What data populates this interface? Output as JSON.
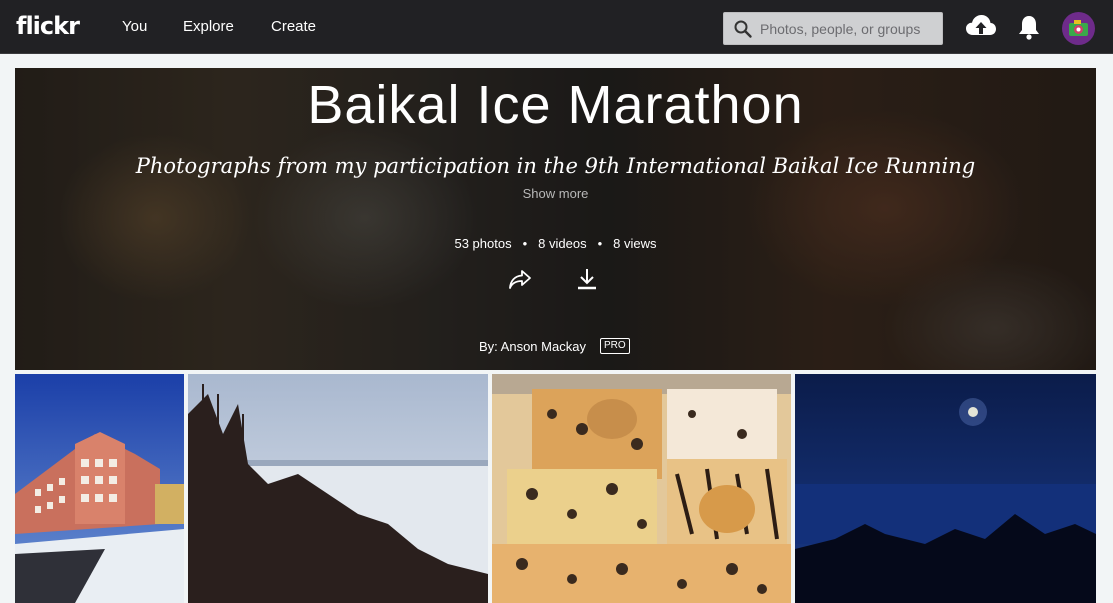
{
  "topbar": {
    "logo": "flickr",
    "nav": {
      "you": "You",
      "explore": "Explore",
      "create": "Create"
    },
    "search_placeholder": "Photos, people, or groups",
    "icons": [
      "search-icon",
      "upload-icon",
      "bell-icon",
      "avatar"
    ]
  },
  "album": {
    "title": "Baikal Ice Marathon",
    "description": "Photographs from my participation in the 9th International Baikal Ice Running",
    "show_more": "Show more",
    "stats": {
      "photos": "53 photos",
      "videos": "8 videos",
      "views": "8 views"
    },
    "byline": "By: Anson Mackay",
    "badge": "PRO"
  },
  "photos": [
    {
      "id": "photo-1"
    },
    {
      "id": "photo-2"
    },
    {
      "id": "photo-3"
    },
    {
      "id": "photo-4"
    }
  ],
  "colors": {
    "topbar": "#212124",
    "page_bg": "#f2f5f6",
    "text": "#ffffff"
  }
}
